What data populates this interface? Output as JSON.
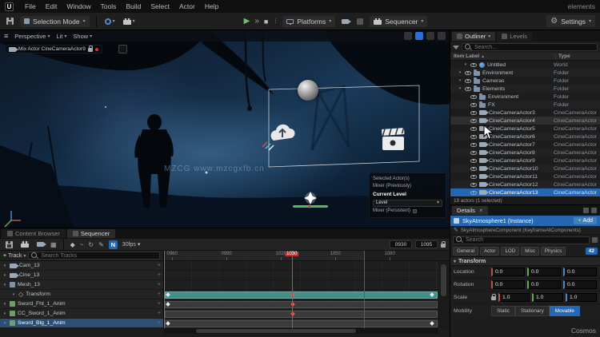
{
  "titlebar": {
    "logo": "U",
    "menus": [
      "File",
      "Edit",
      "Window",
      "Tools",
      "Build",
      "Select",
      "Actor",
      "Help"
    ],
    "project": "elements"
  },
  "toolbar": {
    "mode_label": "Selection Mode",
    "platforms_label": "Platforms",
    "sequencer_label": "Sequencer",
    "settings_label": "Settings"
  },
  "viewport": {
    "menu": [
      "Perspective",
      "Lit",
      "Show"
    ],
    "camera_pill": "Mix Actor CineCameraActor9",
    "watermark": "MZCG www.mzcgxfb.cn",
    "info_box": {
      "line1": "Selected Actor(s)",
      "line2": "Mixer (Previously)",
      "title": "Current Level",
      "dropdown": "Level",
      "line3": "Mixer (Persistent)"
    }
  },
  "outliner": {
    "tab_label": "Outliner",
    "tab2_label": "Levels",
    "search_placeholder": "Search...",
    "columns": {
      "label": "Item Label",
      "type": "Type"
    },
    "rows": [
      {
        "name": "Untitled",
        "type": "World",
        "depth": 0,
        "icon": "world",
        "expanded": true
      },
      {
        "name": "Environment",
        "type": "Folder",
        "depth": 1,
        "icon": "folder",
        "expanded": true
      },
      {
        "name": "Cameras",
        "type": "Folder",
        "depth": 1,
        "icon": "folder",
        "expanded": true
      },
      {
        "name": "Elements",
        "type": "Folder",
        "depth": 1,
        "icon": "folder",
        "expanded": true
      },
      {
        "name": "Environment",
        "type": "Folder",
        "depth": 2,
        "icon": "folder",
        "expanded": false
      },
      {
        "name": "FX",
        "type": "Folder",
        "depth": 2,
        "icon": "folder",
        "expanded": false
      },
      {
        "name": "CineCameraActor3",
        "type": "CineCameraActor",
        "depth": 2,
        "icon": "camera"
      },
      {
        "name": "CineCameraActor4",
        "type": "CineCameraActor",
        "depth": 2,
        "icon": "camera",
        "hover": true
      },
      {
        "name": "CineCameraActor5",
        "type": "CineCameraActor",
        "depth": 2,
        "icon": "camera"
      },
      {
        "name": "CineCameraActor6",
        "type": "CineCameraActor",
        "depth": 2,
        "icon": "camera"
      },
      {
        "name": "CineCameraActor7",
        "type": "CineCameraActor",
        "depth": 2,
        "icon": "camera"
      },
      {
        "name": "CineCameraActor8",
        "type": "CineCameraActor",
        "depth": 2,
        "icon": "camera"
      },
      {
        "name": "CineCameraActor9",
        "type": "CineCameraActor",
        "depth": 2,
        "icon": "camera"
      },
      {
        "name": "CineCameraActor10",
        "type": "CineCameraActor",
        "depth": 2,
        "icon": "camera"
      },
      {
        "name": "CineCameraActor11",
        "type": "CineCameraActor",
        "depth": 2,
        "icon": "camera"
      },
      {
        "name": "CineCameraActor12",
        "type": "CineCameraActor",
        "depth": 2,
        "icon": "camera"
      }
    ],
    "selected_row": {
      "name": "CineCameraActor13",
      "type": "CineCameraActor"
    },
    "footer": "19 actors (1 selected)"
  },
  "details": {
    "tab_label": "Details",
    "add_label": "Add",
    "selected_name": "SkyAtmosphere1 (Instance)",
    "component_row": "SkyAtmosphereComponent (KeyframeAllComponents)",
    "search_placeholder": "Search",
    "filters": [
      "General",
      "Actor",
      "LOD",
      "Misc",
      "Physics"
    ],
    "badge": "42",
    "transform": {
      "title": "Transform",
      "rows": [
        {
          "label": "Location",
          "x": "0.0",
          "y": "0.0",
          "z": "0.0"
        },
        {
          "label": "Rotation",
          "x": "0.0",
          "y": "0.0",
          "z": "0.0"
        },
        {
          "label": "Scale",
          "x": "1.0",
          "y": "1.0",
          "z": "1.0"
        }
      ],
      "mobility_label": "Mobility",
      "mobility_options": [
        "Static",
        "Stationary",
        "Movable"
      ],
      "mobility_selected": 2
    }
  },
  "sequencer": {
    "tabs": [
      {
        "label": "Content Browser",
        "active": false
      },
      {
        "label": "Sequencer",
        "active": true
      }
    ],
    "n_badge": "N",
    "fps_label": "30fps",
    "range_start": "0930",
    "range_end": "1095",
    "add_label": "Track",
    "search_placeholder": "Search Tracks",
    "playhead_label": "1030",
    "ruler": [
      {
        "label": "0960",
        "frac": 0.03
      },
      {
        "label": "0990",
        "frac": 0.23
      },
      {
        "label": "1020",
        "frac": 0.43
      },
      {
        "label": "1050",
        "frac": 0.63
      },
      {
        "label": "1080",
        "frac": 0.83
      }
    ],
    "markers": {
      "start": 0.0,
      "end": 0.735,
      "playhead": 0.47
    },
    "tracks": [
      {
        "name": "Cam_13",
        "icon": "camera"
      },
      {
        "name": "Cine_13",
        "icon": "camera"
      },
      {
        "name": "Mesh_13",
        "icon": "mesh"
      },
      {
        "name": "Transform",
        "icon": "transform",
        "child": true,
        "bar": "teal"
      },
      {
        "name": "Sword_Fht_1_Anim",
        "icon": "anim",
        "bar": "gray"
      },
      {
        "name": "CC_Sword_1_Anim",
        "icon": "anim",
        "bar": "gray"
      },
      {
        "name": "Sword_Blg_1_Anim",
        "icon": "anim",
        "bar": "gray",
        "selected": true
      }
    ],
    "keyframes": [
      {
        "track": 3,
        "frac": 0.01,
        "color": "#e8e8e8"
      },
      {
        "track": 3,
        "frac": 0.47,
        "color": "#e05a4f"
      },
      {
        "track": 3,
        "frac": 0.985,
        "color": "#e8e8e8"
      },
      {
        "track": 4,
        "frac": 0.01,
        "color": "#e8e8e8"
      },
      {
        "track": 4,
        "frac": 0.47,
        "color": "#e05a4f"
      },
      {
        "track": 5,
        "frac": 0.47,
        "color": "#e05a4f"
      },
      {
        "track": 6,
        "frac": 0.01,
        "color": "#e8e8e8"
      },
      {
        "track": 6,
        "frac": 0.985,
        "color": "#e8e8e8"
      }
    ]
  },
  "status": {
    "right": "Cosmos"
  }
}
